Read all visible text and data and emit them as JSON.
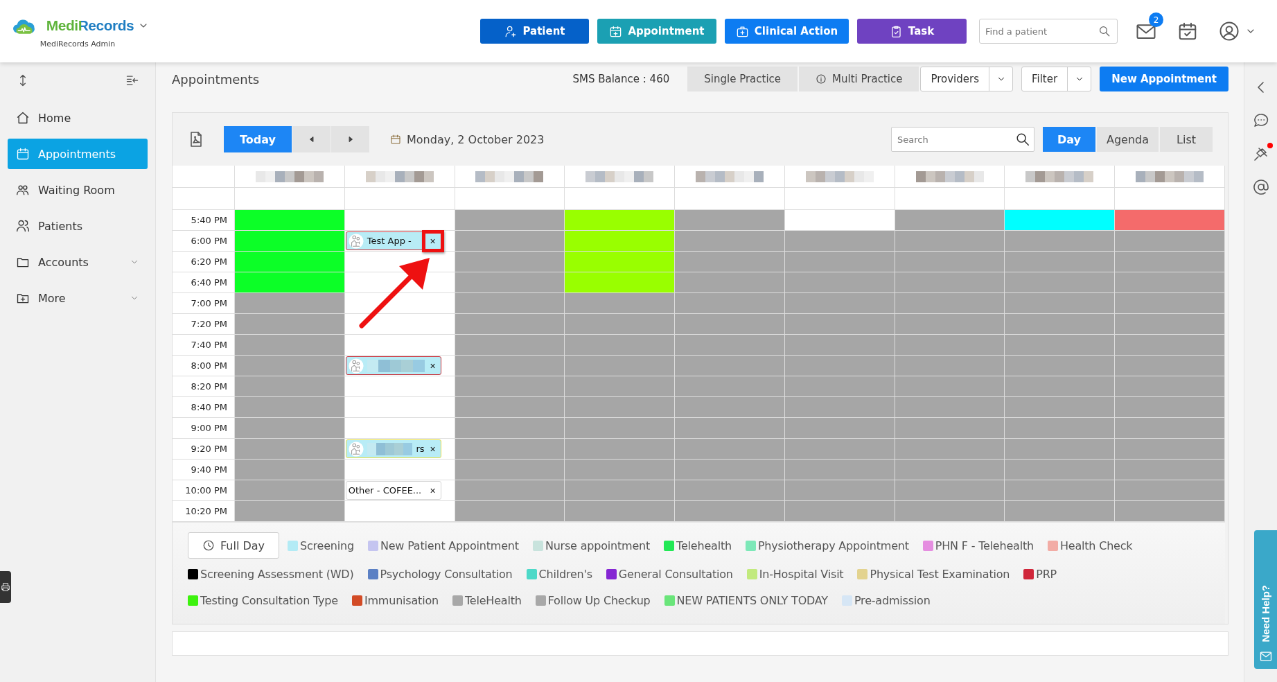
{
  "header": {
    "brand": "MediRecords",
    "subtitle": "MediRecords Admin",
    "actions": [
      {
        "label": "Patient",
        "kind": "patient"
      },
      {
        "label": "Appointment",
        "kind": "appointment"
      },
      {
        "label": "Clinical Action",
        "kind": "clinical"
      },
      {
        "label": "Task",
        "kind": "task"
      }
    ],
    "search": {
      "placeholder": "Find a patient"
    },
    "mail_badge": "2"
  },
  "sidebar": {
    "items": [
      {
        "label": "Home",
        "selected": false,
        "expandable": false
      },
      {
        "label": "Appointments",
        "selected": true,
        "expandable": false
      },
      {
        "label": "Waiting Room",
        "selected": false,
        "expandable": false
      },
      {
        "label": "Patients",
        "selected": false,
        "expandable": false
      },
      {
        "label": "Accounts",
        "selected": false,
        "expandable": true
      },
      {
        "label": "More",
        "selected": false,
        "expandable": true
      }
    ]
  },
  "page": {
    "title": "Appointments",
    "sms_balance": "SMS Balance : 460",
    "practice_tabs": [
      {
        "label": "Single Practice",
        "info": false
      },
      {
        "label": "Multi Practice",
        "info": true
      }
    ],
    "dropdowns": [
      "Providers",
      "Filter"
    ],
    "new_button": "New Appointment"
  },
  "calendar": {
    "today": "Today",
    "date": "Monday, 2 October 2023",
    "search": {
      "placeholder": "Search"
    },
    "views": [
      {
        "label": "Day",
        "selected": true
      },
      {
        "label": "Agenda",
        "selected": false
      },
      {
        "label": "List",
        "selected": false
      }
    ],
    "times": [
      "5:40 PM",
      "6:00 PM",
      "6:20 PM",
      "6:40 PM",
      "7:00 PM",
      "7:20 PM",
      "7:40 PM",
      "8:00 PM",
      "8:20 PM",
      "8:40 PM",
      "9:00 PM",
      "9:20 PM",
      "9:40 PM",
      "10:00 PM",
      "10:20 PM"
    ],
    "providers": [
      {
        "cells": [
          {
            "color": "#0cff27"
          },
          {
            "color": "#0cff27"
          },
          {
            "color": "#0cff27"
          },
          {
            "color": "#0cff27"
          },
          {
            "color": "#a6a6a6"
          },
          {
            "color": "#a6a6a6"
          },
          {
            "color": "#a6a6a6"
          },
          {
            "color": "#a6a6a6"
          },
          {
            "color": "#a6a6a6"
          },
          {
            "color": "#a6a6a6"
          },
          {
            "color": "#a6a6a6"
          },
          {
            "color": "#a6a6a6"
          },
          {
            "color": "#a6a6a6"
          },
          {
            "color": "#a6a6a6"
          },
          {
            "color": "#a6a6a6"
          }
        ]
      },
      {
        "cells": [
          {
            "color": "#ffffff"
          },
          {
            "color": "#ffffff",
            "appointment": {
              "title": "Test App -",
              "close": "×",
              "kind": "patient",
              "redacted": false,
              "color": "#c8313a",
              "highlighted": true
            }
          },
          {
            "color": "#ffffff"
          },
          {
            "color": "#ffffff"
          },
          {
            "color": "#ffffff"
          },
          {
            "color": "#ffffff"
          },
          {
            "color": "#ffffff"
          },
          {
            "color": "#ffffff",
            "appointment": {
              "close": "×",
              "kind": "patient",
              "redacted": true,
              "color": "#c8313a",
              "highlighted": false
            }
          },
          {
            "color": "#ffffff"
          },
          {
            "color": "#ffffff"
          },
          {
            "color": "#ffffff"
          },
          {
            "color": "#ffffff",
            "appointment": {
              "tail": "rs",
              "close": "×",
              "kind": "patient",
              "redacted": true,
              "color": "#e8e04a",
              "highlighted": false
            }
          },
          {
            "color": "#ffffff"
          },
          {
            "color": "#ffffff",
            "appointment": {
              "title": "Other - COFEE...",
              "close": "×",
              "kind": "other",
              "redacted": false,
              "color": "#d4d4d4",
              "highlighted": false
            }
          },
          {
            "color": "#ffffff"
          }
        ]
      },
      {
        "cells": [
          {
            "color": "#a6a6a6"
          },
          {
            "color": "#a6a6a6"
          },
          {
            "color": "#a6a6a6"
          },
          {
            "color": "#a6a6a6"
          },
          {
            "color": "#a6a6a6"
          },
          {
            "color": "#a6a6a6"
          },
          {
            "color": "#a6a6a6"
          },
          {
            "color": "#a6a6a6"
          },
          {
            "color": "#a6a6a6"
          },
          {
            "color": "#a6a6a6"
          },
          {
            "color": "#a6a6a6"
          },
          {
            "color": "#a6a6a6"
          },
          {
            "color": "#a6a6a6"
          },
          {
            "color": "#a6a6a6"
          },
          {
            "color": "#a6a6a6"
          }
        ]
      },
      {
        "cells": [
          {
            "color": "#99ff00"
          },
          {
            "color": "#99ff00"
          },
          {
            "color": "#99ff00"
          },
          {
            "color": "#99ff00"
          },
          {
            "color": "#a6a6a6"
          },
          {
            "color": "#a6a6a6"
          },
          {
            "color": "#a6a6a6"
          },
          {
            "color": "#a6a6a6"
          },
          {
            "color": "#a6a6a6"
          },
          {
            "color": "#a6a6a6"
          },
          {
            "color": "#a6a6a6"
          },
          {
            "color": "#a6a6a6"
          },
          {
            "color": "#a6a6a6"
          },
          {
            "color": "#a6a6a6"
          },
          {
            "color": "#a6a6a6"
          }
        ]
      },
      {
        "cells": [
          {
            "color": "#a6a6a6"
          },
          {
            "color": "#a6a6a6"
          },
          {
            "color": "#a6a6a6"
          },
          {
            "color": "#a6a6a6"
          },
          {
            "color": "#a6a6a6"
          },
          {
            "color": "#a6a6a6"
          },
          {
            "color": "#a6a6a6"
          },
          {
            "color": "#a6a6a6"
          },
          {
            "color": "#a6a6a6"
          },
          {
            "color": "#a6a6a6"
          },
          {
            "color": "#a6a6a6"
          },
          {
            "color": "#a6a6a6"
          },
          {
            "color": "#a6a6a6"
          },
          {
            "color": "#a6a6a6"
          },
          {
            "color": "#a6a6a6"
          }
        ]
      },
      {
        "cells": [
          {
            "color": "#ffffff"
          },
          {
            "color": "#a6a6a6"
          },
          {
            "color": "#a6a6a6"
          },
          {
            "color": "#a6a6a6"
          },
          {
            "color": "#a6a6a6"
          },
          {
            "color": "#a6a6a6"
          },
          {
            "color": "#a6a6a6"
          },
          {
            "color": "#a6a6a6"
          },
          {
            "color": "#a6a6a6"
          },
          {
            "color": "#a6a6a6"
          },
          {
            "color": "#a6a6a6"
          },
          {
            "color": "#a6a6a6"
          },
          {
            "color": "#a6a6a6"
          },
          {
            "color": "#a6a6a6"
          },
          {
            "color": "#a6a6a6"
          }
        ]
      },
      {
        "cells": [
          {
            "color": "#a6a6a6"
          },
          {
            "color": "#a6a6a6"
          },
          {
            "color": "#a6a6a6"
          },
          {
            "color": "#a6a6a6"
          },
          {
            "color": "#a6a6a6"
          },
          {
            "color": "#a6a6a6"
          },
          {
            "color": "#a6a6a6"
          },
          {
            "color": "#a6a6a6"
          },
          {
            "color": "#a6a6a6"
          },
          {
            "color": "#a6a6a6"
          },
          {
            "color": "#a6a6a6"
          },
          {
            "color": "#a6a6a6"
          },
          {
            "color": "#a6a6a6"
          },
          {
            "color": "#a6a6a6"
          },
          {
            "color": "#a6a6a6"
          }
        ]
      },
      {
        "cells": [
          {
            "color": "#00ffff"
          },
          {
            "color": "#a6a6a6"
          },
          {
            "color": "#a6a6a6"
          },
          {
            "color": "#a6a6a6"
          },
          {
            "color": "#a6a6a6"
          },
          {
            "color": "#a6a6a6"
          },
          {
            "color": "#a6a6a6"
          },
          {
            "color": "#a6a6a6"
          },
          {
            "color": "#a6a6a6"
          },
          {
            "color": "#a6a6a6"
          },
          {
            "color": "#a6a6a6"
          },
          {
            "color": "#a6a6a6"
          },
          {
            "color": "#a6a6a6"
          },
          {
            "color": "#a6a6a6"
          },
          {
            "color": "#a6a6a6"
          }
        ]
      },
      {
        "cells": [
          {
            "color": "#f46b6b"
          },
          {
            "color": "#a6a6a6"
          },
          {
            "color": "#a6a6a6"
          },
          {
            "color": "#a6a6a6"
          },
          {
            "color": "#a6a6a6"
          },
          {
            "color": "#a6a6a6"
          },
          {
            "color": "#a6a6a6"
          },
          {
            "color": "#a6a6a6"
          },
          {
            "color": "#a6a6a6"
          },
          {
            "color": "#a6a6a6"
          },
          {
            "color": "#a6a6a6"
          },
          {
            "color": "#a6a6a6"
          },
          {
            "color": "#a6a6a6"
          },
          {
            "color": "#a6a6a6"
          },
          {
            "color": "#a6a6a6"
          }
        ]
      }
    ]
  },
  "legend": {
    "full_day": "Full Day",
    "items": [
      {
        "label": "Screening",
        "color": "#b3ebf5"
      },
      {
        "label": "New Patient Appointment",
        "color": "#c5c5f0"
      },
      {
        "label": "Nurse appointment",
        "color": "#c8e3dd"
      },
      {
        "label": "Telehealth",
        "color": "#22e855"
      },
      {
        "label": "Physiotherapy Appointment",
        "color": "#7de8b8"
      },
      {
        "label": "PHN F - Telehealth",
        "color": "#e58ee0"
      },
      {
        "label": "Health Check",
        "color": "#f2aca5"
      },
      {
        "label": "Screening Assessment (WD)",
        "color": "#000000"
      },
      {
        "label": "Psychology Consultation",
        "color": "#5b80c4"
      },
      {
        "label": "Children's",
        "color": "#4dd9c8"
      },
      {
        "label": "General Consultation",
        "color": "#8526d3"
      },
      {
        "label": "In-Hospital Visit",
        "color": "#c2ea7d"
      },
      {
        "label": "Physical Test Examination",
        "color": "#e3d38f"
      },
      {
        "label": "PRP",
        "color": "#d0263a"
      },
      {
        "label": "Testing Consultation Type",
        "color": "#3df20e"
      },
      {
        "label": "Immunisation",
        "color": "#d24b26"
      },
      {
        "label": "TeleHealth",
        "color": "#a8a8a8"
      },
      {
        "label": "Follow Up Checkup",
        "color": "#a8a8a8"
      },
      {
        "label": "NEW PATIENTS ONLY TODAY",
        "color": "#6ae57a"
      },
      {
        "label": "Pre-admission",
        "color": "#d6e6f5"
      }
    ]
  },
  "help": {
    "label": "Need Help?",
    "pin_alert": true
  }
}
